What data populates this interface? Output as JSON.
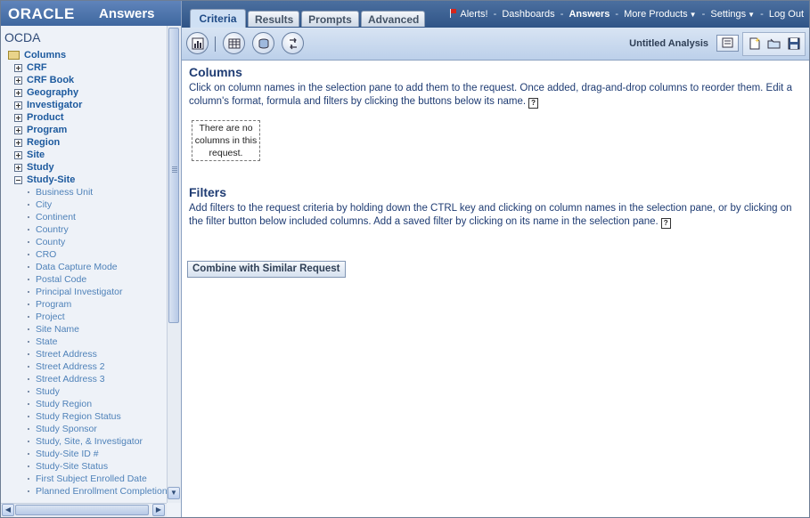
{
  "brand": {
    "oracle": "ORACLE",
    "product": "Answers"
  },
  "subject_area": "OCDA",
  "tree": {
    "root_label": "Columns",
    "folders": [
      "CRF",
      "CRF Book",
      "Geography",
      "Investigator",
      "Product",
      "Program",
      "Region",
      "Site",
      "Study"
    ],
    "expanded_folder": "Study-Site",
    "columns": [
      "Business Unit",
      "City",
      "Continent",
      "Country",
      "County",
      "CRO",
      "Data Capture Mode",
      "Postal Code",
      "Principal Investigator",
      "Program",
      "Project",
      "Site Name",
      "State",
      "Street Address",
      "Street Address 2",
      "Street Address 3",
      "Study",
      "Study Region",
      "Study Region Status",
      "Study Sponsor",
      "Study, Site, & Investigator",
      "Study-Site ID #",
      "Study-Site Status",
      "First Subject Enrolled Date",
      "Planned Enrollment Completion"
    ]
  },
  "tabs": [
    "Criteria",
    "Results",
    "Prompts",
    "Advanced"
  ],
  "active_tab": "Criteria",
  "topnav": {
    "alerts": "Alerts!",
    "dashboards": "Dashboards",
    "answers": "Answers",
    "more_products": "More Products",
    "settings": "Settings",
    "logout": "Log Out",
    "separator": "-"
  },
  "analysis_name": "Untitled Analysis",
  "columns_section": {
    "title": "Columns",
    "text": "Click on column names in the selection pane to add them to the request. Once added, drag-and-drop columns to reorder them. Edit a column's format, formula and filters by clicking the buttons below its name.",
    "empty_text": "There are no columns in this request."
  },
  "filters_section": {
    "title": "Filters",
    "text": "Add filters to the request criteria by holding down the CTRL key and clicking on column names in the selection pane, or by clicking on the filter button below included columns. Add a saved filter by clicking on its name in the selection pane."
  },
  "combine_button": "Combine with Similar Request",
  "icons": {
    "help": "?",
    "scroll_up": "▲",
    "scroll_down": "▼",
    "scroll_left": "◀",
    "scroll_right": "▶",
    "caret": "▼"
  },
  "colors": {
    "accent": "#3f679f",
    "link": "#1d5a9e",
    "heading": "#1f3c73",
    "alert_flag": "#d4241b"
  }
}
